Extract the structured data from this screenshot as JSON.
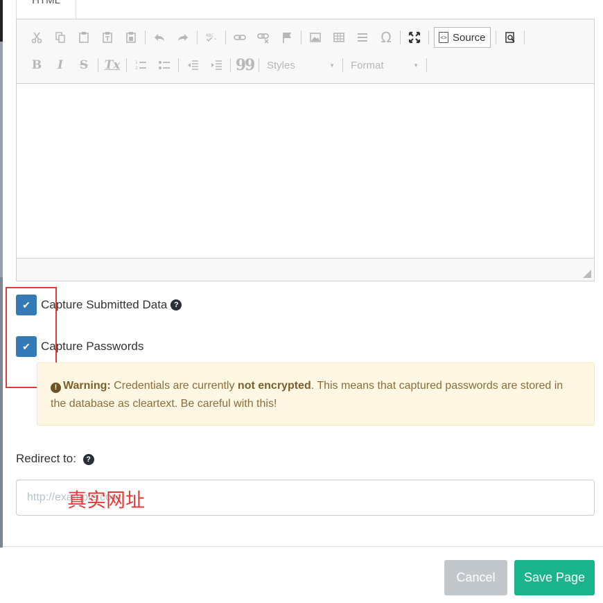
{
  "tab": {
    "label": "HTML"
  },
  "editor": {
    "toolbar_row1": [
      "cut-icon",
      "copy-icon",
      "paste-icon",
      "paste-text-icon",
      "paste-word-icon",
      "undo-icon",
      "redo-icon",
      "spellcheck-icon",
      "link-icon",
      "unlink-icon",
      "anchor-icon",
      "image-icon",
      "table-icon",
      "horizontal-rule-icon",
      "special-char-icon",
      "maximize-icon",
      "source-icon",
      "preview-icon"
    ],
    "source_label": "Source",
    "styles_label": "Styles",
    "format_label": "Format",
    "bold": "B",
    "italic": "I",
    "strike": "S",
    "remove_format": "Tx",
    "blockquote": "99",
    "omega": "Ω"
  },
  "capture_submitted": {
    "label": "Capture Submitted Data",
    "checked": true
  },
  "capture_passwords": {
    "label": "Capture Passwords",
    "checked": true
  },
  "warning": {
    "title": "Warning:",
    "text_before": " Credentials are currently ",
    "emphasis": "not encrypted",
    "text_after": ". This means that captured passwords are stored in the database as cleartext. Be careful with this!"
  },
  "redirect": {
    "label": "Redirect to:",
    "placeholder": "http://example.com"
  },
  "annotation": {
    "text": "真实网址",
    "color": "#e53935"
  },
  "buttons": {
    "cancel": "Cancel",
    "save": "Save Page"
  },
  "colors": {
    "checkbox": "#337ab7",
    "save": "#1bb38c",
    "cancel": "#c2c7cb",
    "warning_bg": "#fdf7e3"
  }
}
